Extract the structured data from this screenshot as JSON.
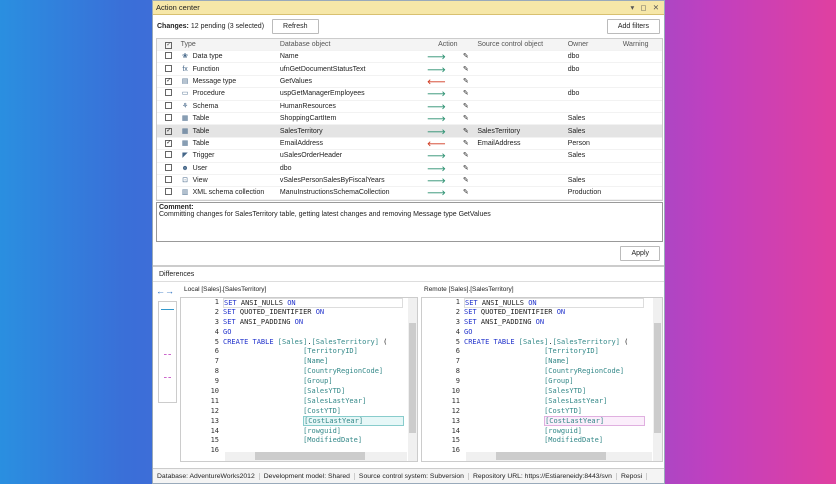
{
  "window": {
    "title": "Action center",
    "controls": "▾ ◻ ✕"
  },
  "toolbar": {
    "changes_label": "Changes:",
    "changes_value": "12 pending (3 selected)",
    "refresh": "Refresh",
    "add_filters": "Add filters"
  },
  "grid": {
    "headers": [
      "Type",
      "Database object",
      "Action",
      "Source control object",
      "Owner",
      "Warning"
    ],
    "rows": [
      {
        "checked": false,
        "icon": "data-type-icon",
        "glyph": "❀",
        "type": "Data type",
        "object": "Name",
        "action": "right",
        "sco": "",
        "owner": "dbo"
      },
      {
        "checked": false,
        "icon": "function-icon",
        "glyph": "fx",
        "type": "Function",
        "object": "ufnGetDocumentStatusText",
        "action": "right",
        "sco": "",
        "owner": "dbo"
      },
      {
        "checked": true,
        "icon": "message-type-icon",
        "glyph": "▤",
        "type": "Message type",
        "object": "GetValues",
        "action": "left",
        "sco": "",
        "owner": ""
      },
      {
        "checked": false,
        "icon": "procedure-icon",
        "glyph": "▭",
        "type": "Procedure",
        "object": "uspGetManagerEmployees",
        "action": "right",
        "sco": "",
        "owner": "dbo"
      },
      {
        "checked": false,
        "icon": "schema-icon",
        "glyph": "⚘",
        "type": "Schema",
        "object": "HumanResources",
        "action": "right",
        "sco": "",
        "owner": ""
      },
      {
        "checked": false,
        "icon": "table-icon",
        "glyph": "▦",
        "type": "Table",
        "object": "ShoppingCartItem",
        "action": "right",
        "sco": "",
        "owner": "Sales"
      },
      {
        "checked": true,
        "icon": "table-icon",
        "glyph": "▦",
        "type": "Table",
        "object": "SalesTerritory",
        "action": "right",
        "sco": "SalesTerritory",
        "owner": "Sales",
        "selected": true
      },
      {
        "checked": true,
        "icon": "table-icon",
        "glyph": "▦",
        "type": "Table",
        "object": "EmailAddress",
        "action": "left",
        "sco": "EmailAddress",
        "owner": "Person"
      },
      {
        "checked": false,
        "icon": "trigger-icon",
        "glyph": "◤",
        "type": "Trigger",
        "object": "uSalesOrderHeader",
        "action": "right",
        "sco": "",
        "owner": "Sales"
      },
      {
        "checked": false,
        "icon": "user-icon",
        "glyph": "☻",
        "type": "User",
        "object": "dbo",
        "action": "right",
        "sco": "",
        "owner": ""
      },
      {
        "checked": false,
        "icon": "view-icon",
        "glyph": "⊡",
        "type": "View",
        "object": "vSalesPersonSalesByFiscalYears",
        "action": "right",
        "sco": "",
        "owner": "Sales"
      },
      {
        "checked": false,
        "icon": "xml-schema-icon",
        "glyph": "▥",
        "type": "XML schema collection",
        "object": "ManuInstructionsSchemaCollection",
        "action": "right",
        "sco": "",
        "owner": "Production"
      }
    ]
  },
  "comment": {
    "label": "Comment:",
    "text": "Committing changes for SalesTerritory table, getting latest changes and removing Message type GetValues"
  },
  "apply": "Apply",
  "diff": {
    "title": "Differences",
    "local": "Local [Sales].[SalesTerritory]",
    "remote": "Remote [Sales].[SalesTerritory]",
    "lines": [
      [
        [
          "kw",
          "SET "
        ],
        [
          "",
          "ANSI_NULLS "
        ],
        [
          "kw",
          "ON"
        ]
      ],
      [
        [
          "kw",
          "SET "
        ],
        [
          "",
          "QUOTED_IDENTIFIER "
        ],
        [
          "kw",
          "ON"
        ]
      ],
      [
        [
          "kw",
          "SET "
        ],
        [
          "",
          "ANSI_PADDING "
        ],
        [
          "kw",
          "ON"
        ]
      ],
      [
        [
          "kw",
          "GO"
        ]
      ],
      [
        [
          "kw",
          "CREATE TABLE "
        ],
        [
          "id",
          "[Sales]"
        ],
        [
          "",
          "."
        ],
        [
          "id",
          "[SalesTerritory]"
        ],
        [
          "",
          " ("
        ]
      ],
      [
        [
          "",
          "                   "
        ],
        [
          "id",
          "[TerritoryID]"
        ]
      ],
      [
        [
          "",
          "                   "
        ],
        [
          "id",
          "[Name]"
        ]
      ],
      [
        [
          "",
          "                   "
        ],
        [
          "id",
          "[CountryRegionCode]"
        ]
      ],
      [
        [
          "",
          "                   "
        ],
        [
          "id",
          "[Group]"
        ]
      ],
      [
        [
          "",
          "                   "
        ],
        [
          "id",
          "[SalesYTD]"
        ]
      ],
      [
        [
          "",
          "                   "
        ],
        [
          "id",
          "[SalesLastYear]"
        ]
      ],
      [
        [
          "",
          "                   "
        ],
        [
          "id",
          "[CostYTD]"
        ]
      ],
      [
        [
          "",
          "                   "
        ],
        [
          "id",
          "[CostLastYear]"
        ]
      ],
      [
        [
          "",
          "                   "
        ],
        [
          "id",
          "[rowguid]"
        ]
      ],
      [
        [
          "",
          "                   "
        ],
        [
          "id",
          "[ModifiedDate]"
        ]
      ],
      []
    ]
  },
  "status": [
    "Database: AdventureWorks2012",
    "Development model: Shared",
    "Source control system: Subversion",
    "Repository URL: https://Estiareneidy:8443/svn",
    "Reposi"
  ]
}
